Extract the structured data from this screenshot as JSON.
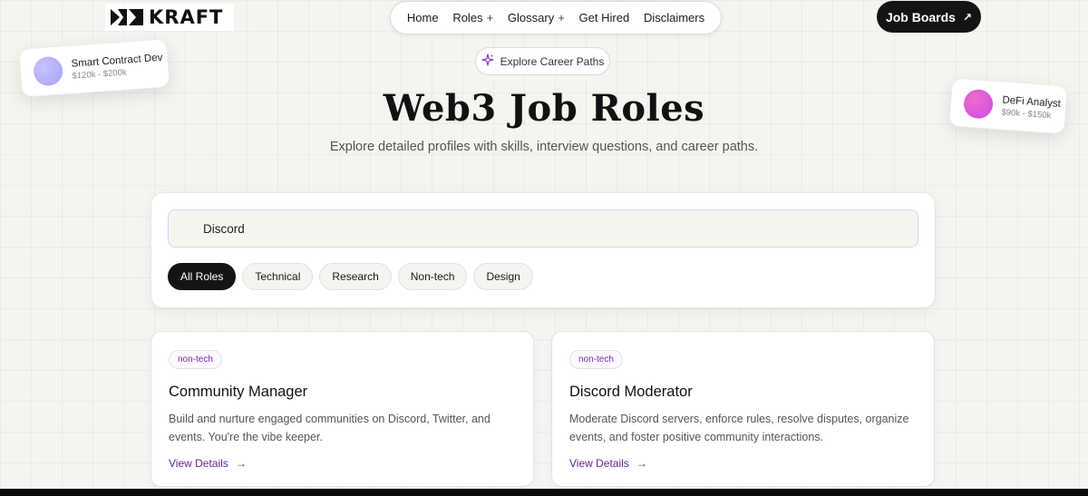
{
  "brand": {
    "name": "KRAFT"
  },
  "nav": {
    "items": [
      {
        "label": "Home",
        "has_plus": false
      },
      {
        "label": "Roles",
        "has_plus": true
      },
      {
        "label": "Glossary",
        "has_plus": true
      },
      {
        "label": "Get Hired",
        "has_plus": false
      },
      {
        "label": "Disclaimers",
        "has_plus": false
      }
    ],
    "plus_glyph": "+"
  },
  "cta": {
    "label": "Job Boards",
    "arrow": "↗"
  },
  "floating_cards": [
    {
      "title": "Smart Contract Dev",
      "salary": "$120k - $200k",
      "orb_color": "#b4b1fb"
    },
    {
      "title": "DeFi Analyst",
      "salary": "$90k - $150k",
      "orb_color": "#e15bd6"
    }
  ],
  "hero": {
    "pill": "Explore Career Paths",
    "title": "Web3 Job Roles",
    "subtitle": "Explore detailed profiles with skills, interview questions, and career paths."
  },
  "search": {
    "value": "Discord",
    "placeholder": ""
  },
  "filters": [
    {
      "label": "All Roles",
      "active": true
    },
    {
      "label": "Technical",
      "active": false
    },
    {
      "label": "Research",
      "active": false
    },
    {
      "label": "Non-tech",
      "active": false
    },
    {
      "label": "Design",
      "active": false
    }
  ],
  "roles": [
    {
      "tag": "non-tech",
      "title": "Community Manager",
      "description": "Build and nurture engaged communities on Discord, Twitter, and events. You're the vibe keeper.",
      "link": "View Details",
      "arrow": "→"
    },
    {
      "tag": "non-tech",
      "title": "Discord Moderator",
      "description": "Moderate Discord servers, enforce rules, resolve disputes, organize events, and foster positive community interactions.",
      "link": "View Details",
      "arrow": "→"
    }
  ],
  "colors": {
    "accent_purple": "#6b1f96",
    "dark": "#141414",
    "background": "#f6f4ef"
  },
  "icons": {
    "sparkle": "sparkle-icon",
    "search": "search-icon",
    "arrow_up_right": "arrow-up-right-icon",
    "arrow_right": "arrow-right-icon"
  }
}
